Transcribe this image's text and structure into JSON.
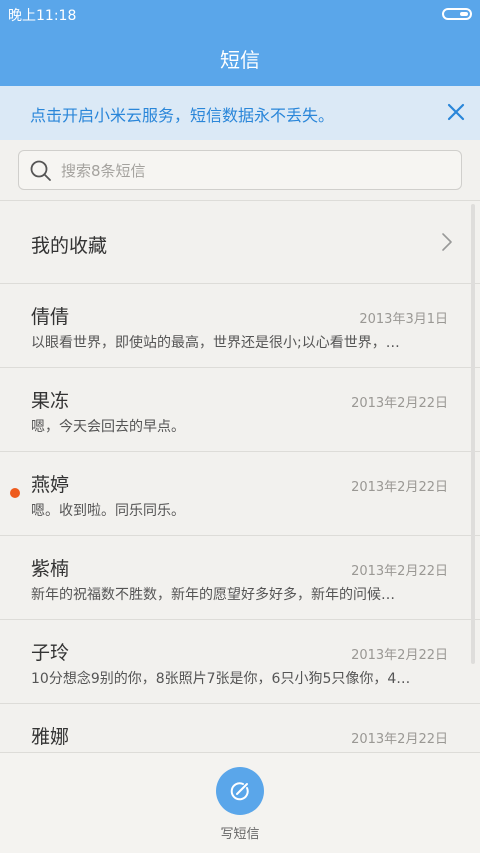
{
  "status": {
    "time": "晚上11:18"
  },
  "header": {
    "title": "短信"
  },
  "banner": {
    "text": "点击开启小米云服务，短信数据永不丢失。"
  },
  "search": {
    "placeholder": "搜索8条短信"
  },
  "favorites": {
    "label": "我的收藏"
  },
  "conversations": [
    {
      "name": "倩倩",
      "date": "2013年3月1日",
      "preview": "以眼看世界，即使站的最高，世界还是很小;以心看世界，…",
      "unread": false
    },
    {
      "name": "果冻",
      "date": "2013年2月22日",
      "preview": "嗯，今天会回去的早点。",
      "unread": false
    },
    {
      "name": "燕婷",
      "date": "2013年2月22日",
      "preview": "嗯。收到啦。同乐同乐。",
      "unread": true
    },
    {
      "name": "紫楠",
      "date": "2013年2月22日",
      "preview": "新年的祝福数不胜数，新年的愿望好多好多，新年的问候…",
      "unread": false
    },
    {
      "name": "子玲",
      "date": "2013年2月22日",
      "preview": "10分想念9别的你，8张照片7张是你，6只小狗5只像你，4…",
      "unread": false
    },
    {
      "name": "雅娜",
      "date": "2013年2月22日",
      "preview": "",
      "unread": false
    }
  ],
  "compose": {
    "label": "写短信"
  },
  "colors": {
    "accent": "#5aa6ea",
    "banner_text": "#2a86d9",
    "unread_dot": "#ee5b1d"
  }
}
